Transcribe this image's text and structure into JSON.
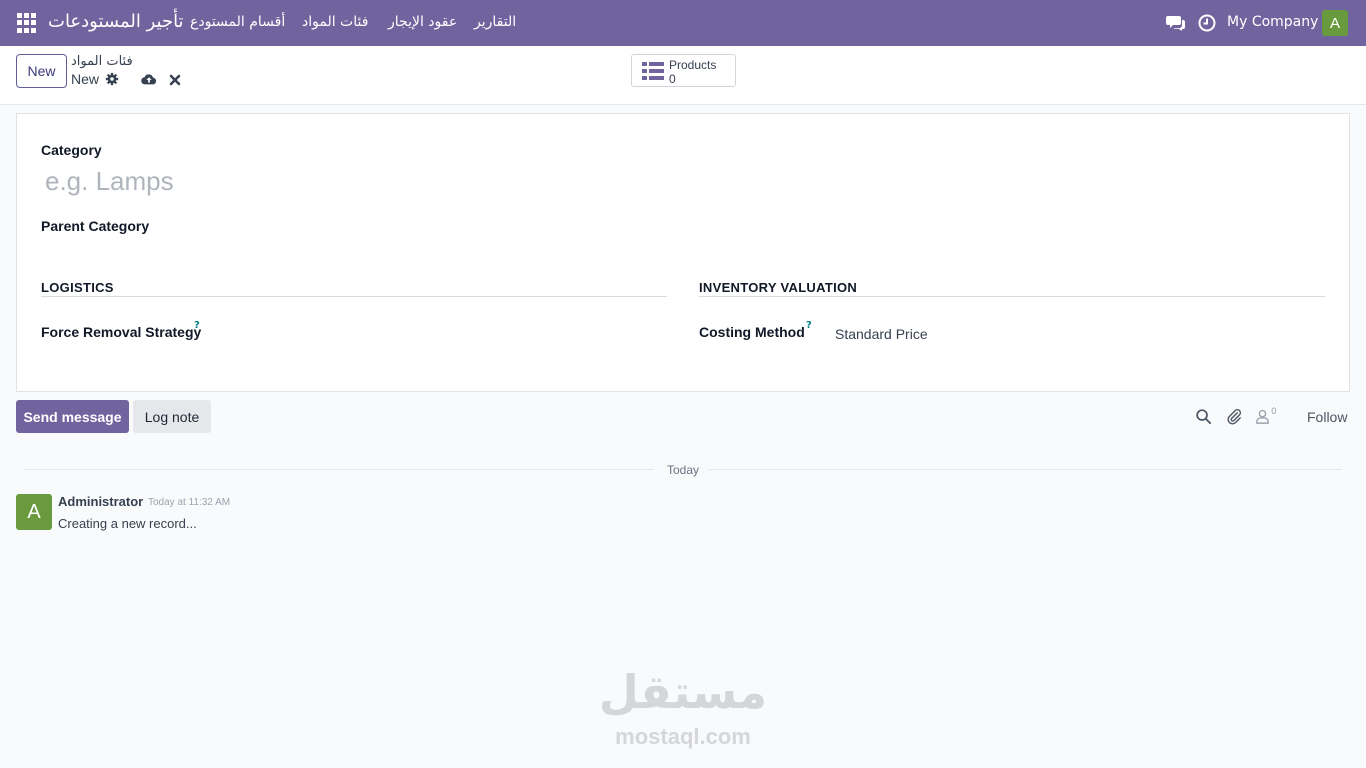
{
  "navbar": {
    "brand": "تأجير المستودعات",
    "menus": [
      "أقسام المستودع",
      "فئات المواد",
      "عقود الإيجار",
      "التقارير"
    ],
    "company": "My Company",
    "user_initial": "A",
    "bg_color": "#71639e"
  },
  "control": {
    "new_label": "New",
    "breadcrumb_parent": "فئات المواد",
    "breadcrumb_current": "New",
    "smart_button": {
      "label": "Products",
      "value": "0",
      "icon": "list-icon"
    }
  },
  "form": {
    "category_label": "Category",
    "category_placeholder": "e.g. Lamps",
    "parent_category_label": "Parent Category",
    "logistics_title": "LOGISTICS",
    "force_removal_label": "Force Removal Strategy",
    "valuation_title": "INVENTORY VALUATION",
    "costing_method_label": "Costing Method",
    "costing_method_value": "Standard Price",
    "help_mark": "?"
  },
  "chatter": {
    "send_label": "Send message",
    "log_label": "Log note",
    "follower_count": "0",
    "follow_label": "Follow",
    "date_separator": "Today",
    "messages": [
      {
        "initial": "A",
        "author": "Administrator",
        "date": "Today at 11:32 AM",
        "body": "Creating a new record..."
      }
    ]
  },
  "watermark": {
    "arabic": "مستقل",
    "latin": "mostaql.com"
  }
}
